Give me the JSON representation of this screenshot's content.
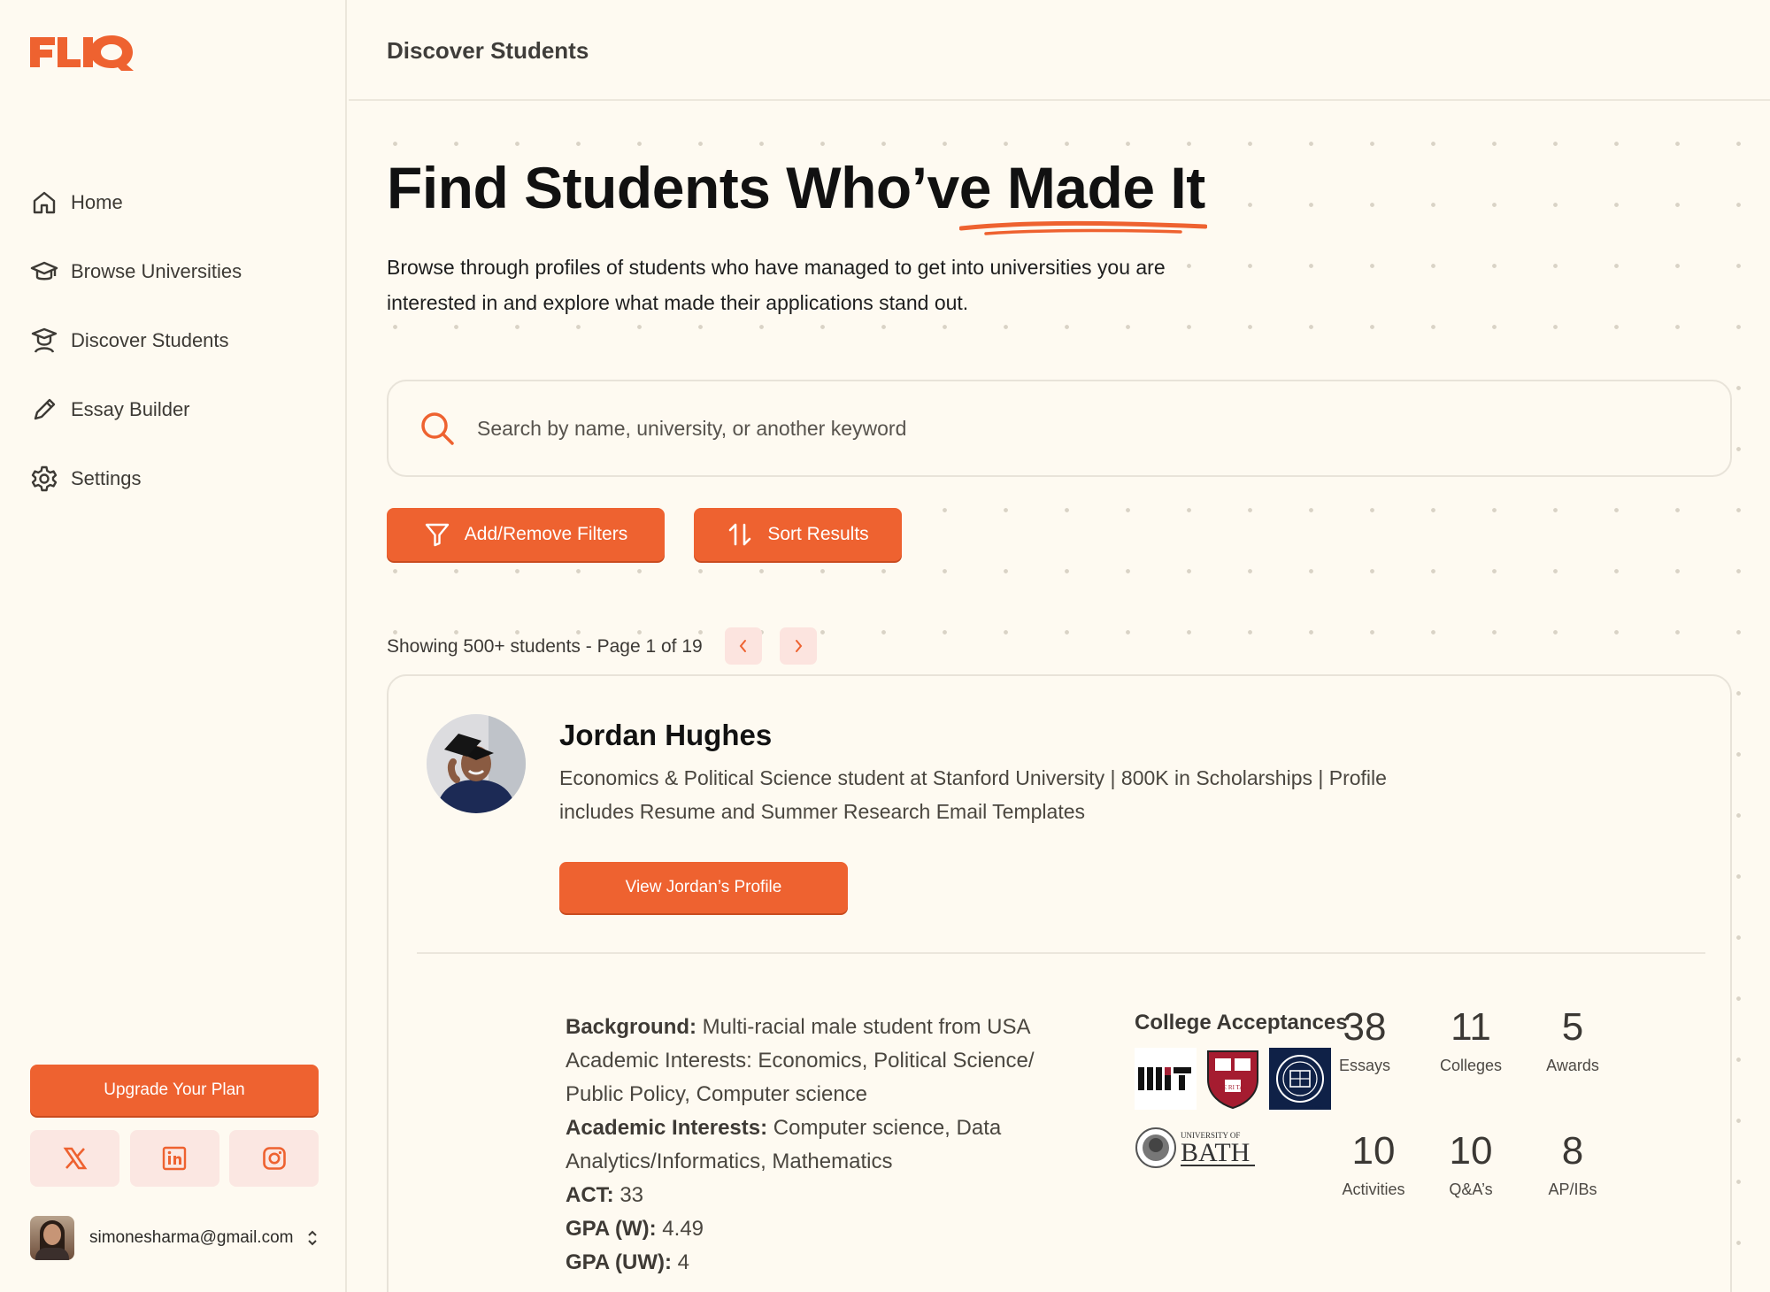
{
  "app": {
    "brand": "FLIQ",
    "accent_color": "#ee6230"
  },
  "sidebar": {
    "items": [
      {
        "label": "Home",
        "icon": "home-icon"
      },
      {
        "label": "Browse Universities",
        "icon": "graduation-cap-icon"
      },
      {
        "label": "Discover Students",
        "icon": "student-icon"
      },
      {
        "label": "Essay Builder",
        "icon": "pencil-icon"
      },
      {
        "label": "Settings",
        "icon": "gear-icon"
      }
    ],
    "upgrade_label": "Upgrade Your Plan",
    "socials": [
      "x-icon",
      "linkedin-icon",
      "instagram-icon"
    ],
    "user_email": "simonesharma@gmail.com"
  },
  "header": {
    "title": "Discover Students"
  },
  "hero": {
    "title_part1": "Find Students Who’ve ",
    "title_part2": "Made It",
    "subtitle": "Browse through profiles of students who have managed to get into universities you are interested in and explore what made their applications stand out."
  },
  "search": {
    "placeholder": "Search by name, university, or another keyword",
    "value": ""
  },
  "actions": {
    "filters_label": "Add/Remove Filters",
    "sort_label": "Sort Results"
  },
  "results": {
    "showing_text": "Showing 500+ students - Page 1 of 19"
  },
  "student": {
    "name": "Jordan Hughes",
    "description": "Economics & Political Science student at Stanford University | 800K in Scholarships | Profile includes Resume and Summer Research Email Templates",
    "view_label": "View Jordan’s Profile",
    "background_label": "Background:",
    "background_value": " Multi-racial male student from USA Academic Interests: Economics, Political Science/ Public Policy, Computer science",
    "interests_label": "Academic Interests:",
    "interests_value": " Computer science, Data Analytics/Informatics, Mathematics",
    "act_label": "ACT:",
    "act_value": " 33",
    "gpa_w_label": "GPA (W):",
    "gpa_w_value": " 4.49",
    "gpa_uw_label": "GPA (UW):",
    "gpa_uw_value": " 4",
    "acceptances_title": "College Acceptances",
    "colleges": {
      "mit": "MIT",
      "harvard": "VE RI TAS",
      "oxford": "UNIVERSITY OF OXFORD",
      "bath_small": "UNIVERSITY OF",
      "bath_big": "BATH"
    },
    "stats": [
      {
        "value": "38",
        "label": "Essays"
      },
      {
        "value": "11",
        "label": "Colleges"
      },
      {
        "value": "5",
        "label": "Awards"
      },
      {
        "value": "10",
        "label": "Activities"
      },
      {
        "value": "10",
        "label": "Q&A’s"
      },
      {
        "value": "8",
        "label": "AP/IBs"
      }
    ]
  }
}
